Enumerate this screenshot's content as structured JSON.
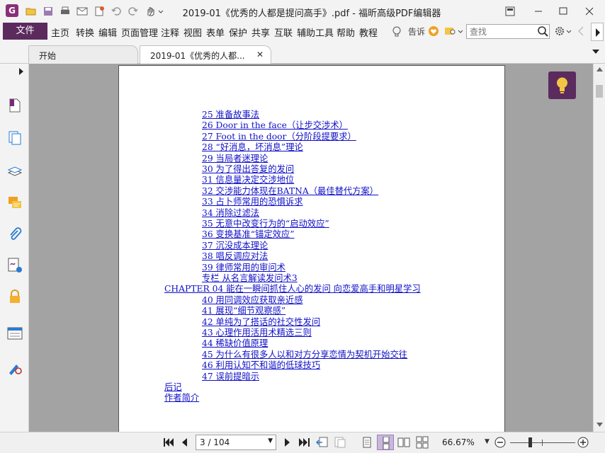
{
  "window": {
    "title": "2019-01《优秀的人都是提问高手》.pdf - 福昕高级PDF编辑器",
    "logo": "G"
  },
  "menu": {
    "file": "文件",
    "items": [
      "主页",
      "转换",
      "编辑",
      "页面管理",
      "注释",
      "视图",
      "表单",
      "保护",
      "共享",
      "互联",
      "辅助工具",
      "帮助",
      "教程"
    ],
    "tellme": "告诉",
    "search_placeholder": "查找"
  },
  "tabs": [
    {
      "label": "开始"
    },
    {
      "label": "2019-01《优秀的人都..."
    }
  ],
  "toc": [
    {
      "text": "25 准备故事法",
      "level": 2
    },
    {
      "text": "26 Door in the face（让步交涉术）",
      "level": 2
    },
    {
      "text": "27 Foot in the door（分阶段提要求）",
      "level": 2
    },
    {
      "text": "28 “好消息，坏消息”理论",
      "level": 2
    },
    {
      "text": "29 当局者迷理论",
      "level": 2
    },
    {
      "text": "30 为了得出答复的发问",
      "level": 2
    },
    {
      "text": "31 信息量决定交涉地位",
      "level": 2
    },
    {
      "text": "32 交涉能力体现在BATNA（最佳替代方案）",
      "level": 2
    },
    {
      "text": "33 占卜师常用的恐惧诉求",
      "level": 2
    },
    {
      "text": "34 消除过滤法",
      "level": 2
    },
    {
      "text": "35 无意中改变行为的“启动效应”",
      "level": 2
    },
    {
      "text": "36 变换基准“锚定效应”",
      "level": 2
    },
    {
      "text": "37 沉没成本理论",
      "level": 2
    },
    {
      "text": "38 唱反调应对法",
      "level": 2
    },
    {
      "text": "39 律师常用的审问术",
      "level": 2
    },
    {
      "text": "专栏 从名言解读发问术3",
      "level": 2
    },
    {
      "text": "CHAPTER 04 能在一瞬间抓住人心的发问 向恋爱高手和明星学习",
      "level": 1
    },
    {
      "text": "40 用同调效应获取亲近感",
      "level": 2
    },
    {
      "text": "41 展现“细节观察感”",
      "level": 2
    },
    {
      "text": "42 单纯为了搭话的社交性发问",
      "level": 2
    },
    {
      "text": "43 心理作用活用术精选三则",
      "level": 2
    },
    {
      "text": "44 稀缺价值原理",
      "level": 2
    },
    {
      "text": "45 为什么有很多人以和对方分享恋情为契机开始交往",
      "level": 2
    },
    {
      "text": "46 利用认知不和谐的低球技巧",
      "level": 2
    },
    {
      "text": "47 误前提暗示",
      "level": 2
    },
    {
      "text": "后记",
      "level": 1
    },
    {
      "text": "作者简介",
      "level": 1
    }
  ],
  "status": {
    "page_display": "3 / 104",
    "zoom": "66.67%"
  },
  "colors": {
    "brand": "#5b2b5e",
    "link": "#1010c8",
    "canvas": "#a3a3a3"
  }
}
